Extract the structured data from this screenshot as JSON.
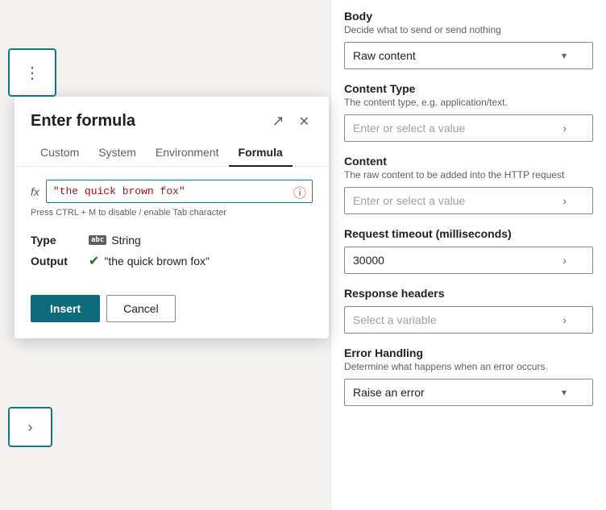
{
  "modal": {
    "title": "Enter formula",
    "tabs": [
      {
        "id": "custom",
        "label": "Custom"
      },
      {
        "id": "system",
        "label": "System"
      },
      {
        "id": "environment",
        "label": "Environment"
      },
      {
        "id": "formula",
        "label": "Formula"
      }
    ],
    "active_tab": "formula",
    "fx_label": "fx",
    "formula_value": "\"the quick brown fox\"",
    "formula_placeholder": "",
    "formula_hint": "Press CTRL + M to disable / enable Tab character",
    "type_label": "Type",
    "type_value": "String",
    "output_label": "Output",
    "output_value": "\"the quick brown fox\"",
    "insert_label": "Insert",
    "cancel_label": "Cancel"
  },
  "right_panel": {
    "body": {
      "title": "Body",
      "description": "Decide what to send or send nothing",
      "selected": "Raw content",
      "chevron": "▾"
    },
    "content_type": {
      "title": "Content Type",
      "description": "The content type, e.g. application/text.",
      "placeholder": "Enter or select a value",
      "chevron": "›"
    },
    "content": {
      "title": "Content",
      "description": "The raw content to be added into the HTTP request",
      "placeholder": "Enter or select a value",
      "chevron": "›"
    },
    "request_timeout": {
      "title": "Request timeout (milliseconds)",
      "value": "30000",
      "chevron": "›"
    },
    "response_headers": {
      "title": "Response headers",
      "placeholder": "Select a variable",
      "chevron": "›"
    },
    "error_handling": {
      "title": "Error Handling",
      "description": "Determine what happens when an error occurs.",
      "selected": "Raise an error",
      "chevron": "▾"
    }
  },
  "icons": {
    "expand": "↗",
    "close": "✕",
    "ellipsis": "⋮",
    "arrow_right": "›",
    "check_circle": "✔",
    "info": "ⓘ"
  }
}
